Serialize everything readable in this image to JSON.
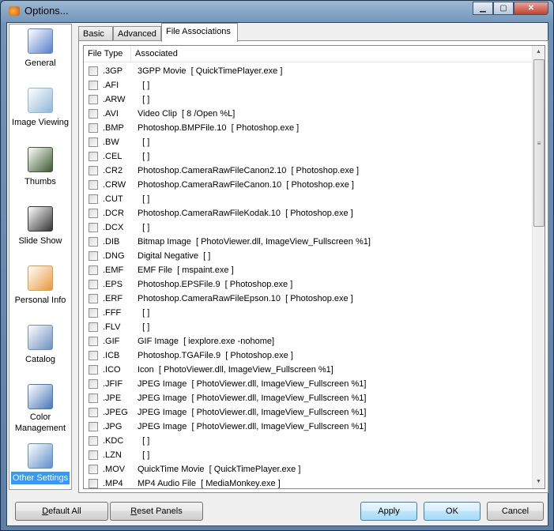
{
  "window": {
    "title": "Options..."
  },
  "sidebar": {
    "items": [
      {
        "label": "General",
        "icon": "general-window-icon",
        "color": "#5b7fc9"
      },
      {
        "label": "Image Viewing",
        "icon": "image-viewing-icon",
        "color": "#8fb8d8"
      },
      {
        "label": "Thumbs",
        "icon": "thumbs-icon",
        "color": "#3c5a30"
      },
      {
        "label": "Slide Show",
        "icon": "film-strip-icon",
        "color": "#333333"
      },
      {
        "label": "Personal Info",
        "icon": "person-icon",
        "color": "#e59a3a"
      },
      {
        "label": "Catalog",
        "icon": "catalog-icon",
        "color": "#6e8fc0"
      },
      {
        "label": "Color Management",
        "icon": "monitor-icon",
        "color": "#4a78b8"
      },
      {
        "label": "Other Settings",
        "icon": "tools-icon",
        "color": "#5f8fc8",
        "selected": true
      }
    ]
  },
  "tabs": [
    {
      "label": "Basic"
    },
    {
      "label": "Advanced"
    },
    {
      "label": "File Associations",
      "active": true
    }
  ],
  "list": {
    "headers": [
      "File Type",
      "Associated"
    ],
    "rows": [
      {
        "ext": ".3GP",
        "assoc": "3GPP Movie  [ QuickTimePlayer.exe ]"
      },
      {
        "ext": ".AFI",
        "assoc": "  [ ]"
      },
      {
        "ext": ".ARW",
        "assoc": "  [ ]"
      },
      {
        "ext": ".AVI",
        "assoc": "Video Clip  [ 8 /Open %L]"
      },
      {
        "ext": ".BMP",
        "assoc": "Photoshop.BMPFile.10  [ Photoshop.exe ]"
      },
      {
        "ext": ".BW",
        "assoc": "  [ ]"
      },
      {
        "ext": ".CEL",
        "assoc": "  [ ]"
      },
      {
        "ext": ".CR2",
        "assoc": "Photoshop.CameraRawFileCanon2.10  [ Photoshop.exe ]"
      },
      {
        "ext": ".CRW",
        "assoc": "Photoshop.CameraRawFileCanon.10  [ Photoshop.exe ]"
      },
      {
        "ext": ".CUT",
        "assoc": "  [ ]"
      },
      {
        "ext": ".DCR",
        "assoc": "Photoshop.CameraRawFileKodak.10  [ Photoshop.exe ]"
      },
      {
        "ext": ".DCX",
        "assoc": "  [ ]"
      },
      {
        "ext": ".DIB",
        "assoc": "Bitmap Image  [ PhotoViewer.dll, ImageView_Fullscreen %1]"
      },
      {
        "ext": ".DNG",
        "assoc": "Digital Negative  [ ]"
      },
      {
        "ext": ".EMF",
        "assoc": "EMF File  [ mspaint.exe ]"
      },
      {
        "ext": ".EPS",
        "assoc": "Photoshop.EPSFile.9  [ Photoshop.exe ]"
      },
      {
        "ext": ".ERF",
        "assoc": "Photoshop.CameraRawFileEpson.10  [ Photoshop.exe ]"
      },
      {
        "ext": ".FFF",
        "assoc": "  [ ]"
      },
      {
        "ext": ".FLV",
        "assoc": "  [ ]"
      },
      {
        "ext": ".GIF",
        "assoc": "GIF Image  [ iexplore.exe -nohome]"
      },
      {
        "ext": ".ICB",
        "assoc": "Photoshop.TGAFile.9  [ Photoshop.exe ]"
      },
      {
        "ext": ".ICO",
        "assoc": "Icon  [ PhotoViewer.dll, ImageView_Fullscreen %1]"
      },
      {
        "ext": ".JFIF",
        "assoc": "JPEG Image  [ PhotoViewer.dll, ImageView_Fullscreen %1]"
      },
      {
        "ext": ".JPE",
        "assoc": "JPEG Image  [ PhotoViewer.dll, ImageView_Fullscreen %1]"
      },
      {
        "ext": ".JPEG",
        "assoc": "JPEG Image  [ PhotoViewer.dll, ImageView_Fullscreen %1]"
      },
      {
        "ext": ".JPG",
        "assoc": "JPEG Image  [ PhotoViewer.dll, ImageView_Fullscreen %1]"
      },
      {
        "ext": ".KDC",
        "assoc": "  [ ]"
      },
      {
        "ext": ".LZN",
        "assoc": "  [ ]"
      },
      {
        "ext": ".MOV",
        "assoc": "QuickTime Movie  [ QuickTimePlayer.exe ]"
      },
      {
        "ext": ".MP4",
        "assoc": "MP4 Audio File  [ MediaMonkey.exe ]"
      }
    ]
  },
  "buttons": {
    "default_all": "Default All",
    "reset_panels": "Reset Panels",
    "apply": "Apply",
    "ok": "OK",
    "cancel": "Cancel"
  }
}
